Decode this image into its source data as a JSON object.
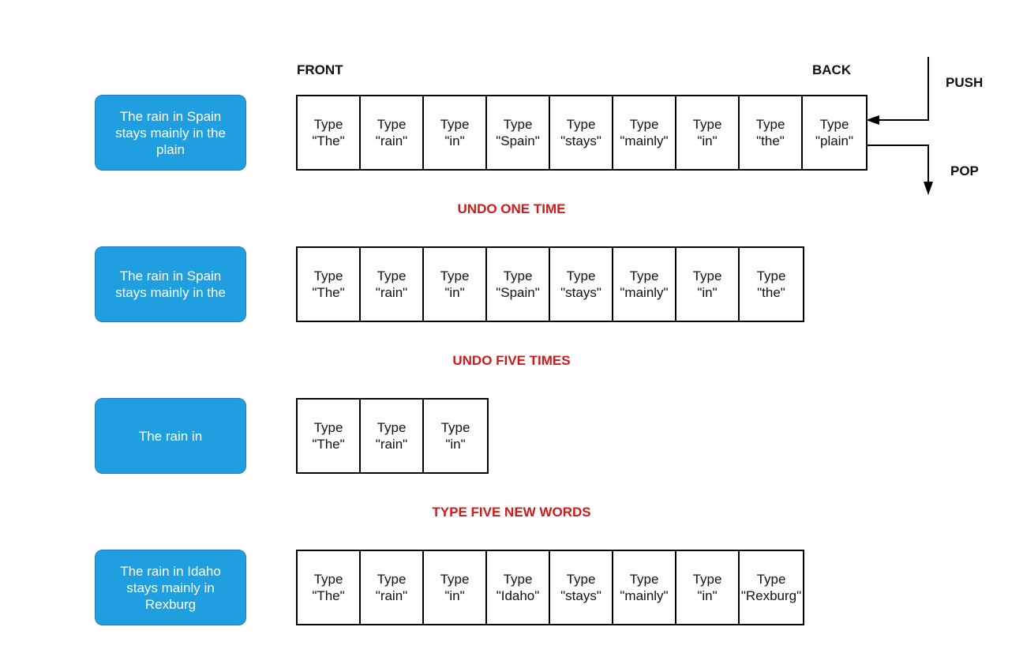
{
  "labels": {
    "front": "FRONT",
    "back": "BACK",
    "push": "PUSH",
    "pop": "POP"
  },
  "colors": {
    "box_fill": "#1f9fdf",
    "box_border": "#1a7fb5",
    "step_label": "#d21919"
  },
  "rows": [
    {
      "text": "The rain in Spain stays mainly in the plain",
      "cells": [
        {
          "action": "Type",
          "word": "\"The\""
        },
        {
          "action": "Type",
          "word": "\"rain\""
        },
        {
          "action": "Type",
          "word": "\"in\""
        },
        {
          "action": "Type",
          "word": "\"Spain\""
        },
        {
          "action": "Type",
          "word": "\"stays\""
        },
        {
          "action": "Type",
          "word": "\"mainly\""
        },
        {
          "action": "Type",
          "word": "\"in\""
        },
        {
          "action": "Type",
          "word": "\"the\""
        },
        {
          "action": "Type",
          "word": "\"plain\""
        }
      ]
    },
    {
      "step": "UNDO ONE TIME",
      "text": "The rain in Spain stays mainly in the",
      "cells": [
        {
          "action": "Type",
          "word": "\"The\""
        },
        {
          "action": "Type",
          "word": "\"rain\""
        },
        {
          "action": "Type",
          "word": "\"in\""
        },
        {
          "action": "Type",
          "word": "\"Spain\""
        },
        {
          "action": "Type",
          "word": "\"stays\""
        },
        {
          "action": "Type",
          "word": "\"mainly\""
        },
        {
          "action": "Type",
          "word": "\"in\""
        },
        {
          "action": "Type",
          "word": "\"the\""
        }
      ]
    },
    {
      "step": "UNDO FIVE TIMES",
      "text": "The rain in",
      "cells": [
        {
          "action": "Type",
          "word": "\"The\""
        },
        {
          "action": "Type",
          "word": "\"rain\""
        },
        {
          "action": "Type",
          "word": "\"in\""
        }
      ]
    },
    {
      "step": "TYPE FIVE NEW WORDS",
      "text": "The rain in Idaho stays mainly in Rexburg",
      "cells": [
        {
          "action": "Type",
          "word": "\"The\""
        },
        {
          "action": "Type",
          "word": "\"rain\""
        },
        {
          "action": "Type",
          "word": "\"in\""
        },
        {
          "action": "Type",
          "word": "\"Idaho\""
        },
        {
          "action": "Type",
          "word": "\"stays\""
        },
        {
          "action": "Type",
          "word": "\"mainly\""
        },
        {
          "action": "Type",
          "word": "\"in\""
        },
        {
          "action": "Type",
          "word": "\"Rexburg\""
        }
      ]
    }
  ]
}
